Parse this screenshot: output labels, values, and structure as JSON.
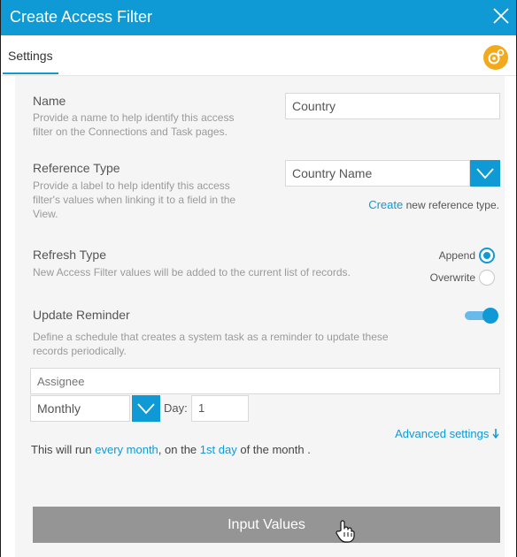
{
  "dialog": {
    "title": "Create Access Filter",
    "close_icon": "close-icon"
  },
  "tabs": [
    {
      "label": "Settings",
      "active": true
    }
  ],
  "settings_icon": "gear-icon",
  "name": {
    "heading": "Name",
    "description_line1": "Provide a name to help identify this access",
    "description_line2": "filter on the Connections and Task pages.",
    "value": "Country"
  },
  "reference_type": {
    "heading": "Reference Type",
    "description_line1": "Provide a label to help identify this access",
    "description_line2": "filter's values when linking it to a field in the",
    "description_line3": "View.",
    "selected": "Country Name",
    "create_link": "Create",
    "create_suffix": "new reference type."
  },
  "refresh_type": {
    "heading": "Refresh Type",
    "description": "New Access Filter values will be added to the current list of records.",
    "options": [
      {
        "label": "Append",
        "checked": true
      },
      {
        "label": "Overwrite",
        "checked": false
      }
    ]
  },
  "update_reminder": {
    "heading": "Update Reminder",
    "enabled": true,
    "description_line1": "Define a schedule that creates a system task as a reminder to update these",
    "description_line2": "records periodically.",
    "assignee_placeholder": "Assignee",
    "frequency": "Monthly",
    "day_label": "Day:",
    "day_value": "1",
    "advanced_link": "Advanced settings",
    "summary_prefix": "This will run",
    "summary_link1": "every month",
    "summary_mid": ", on the",
    "summary_link2": "1st day",
    "summary_suffix": "of the month ."
  },
  "submit_label": "Input Values",
  "colors": {
    "accent": "#0f9ad6",
    "settings_button": "#f2aa1c",
    "submit_button": "#959595"
  }
}
